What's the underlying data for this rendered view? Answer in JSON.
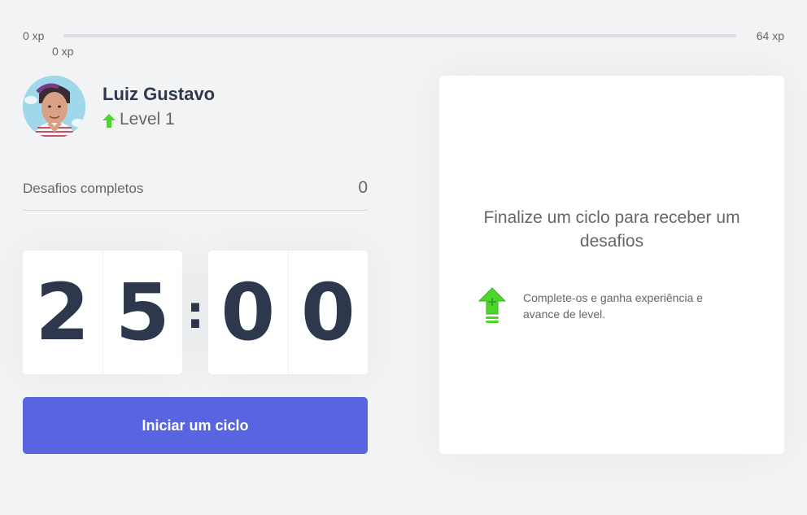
{
  "xp_bar": {
    "min_label": "0 xp",
    "max_label": "64 xp",
    "current_label": "0 xp",
    "progress_percent": 0,
    "fill_color": "#4cd62b"
  },
  "profile": {
    "name": "Luiz Gustavo",
    "level_label": "Level 1",
    "level_icon": "level-up-arrow-icon"
  },
  "completed_challenges": {
    "label": "Desafios completos",
    "value": "0"
  },
  "countdown": {
    "minute_left": "2",
    "minute_right": "5",
    "separator": ":",
    "second_left": "0",
    "second_right": "0"
  },
  "start_button": {
    "label": "Iniciar um ciclo",
    "color": "#5965e0"
  },
  "challenge_box": {
    "title": "Finalize um ciclo para receber um desafios",
    "icon": "level-up-icon",
    "description": "Complete-os e ganha experiência e avance de level."
  },
  "colors": {
    "background": "#f2f3f5",
    "title": "#2e384d",
    "text": "#666666",
    "green": "#4cd62b",
    "blue": "#5965e0"
  }
}
